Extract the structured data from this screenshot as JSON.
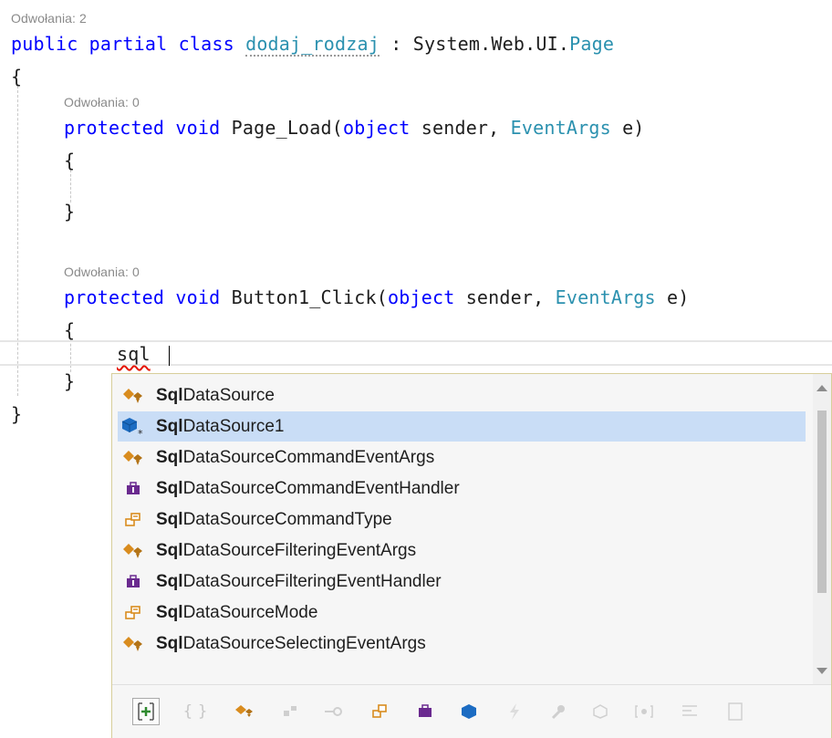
{
  "codelens": {
    "class_refs": "Odwołania: 2",
    "page_load_refs": "Odwołania: 0",
    "button_click_refs": "Odwołania: 0"
  },
  "code": {
    "l1_kw": "public partial class",
    "l1_name": "dodaj_rodzaj",
    "l1_colon": " : ",
    "l1_ns": "System.Web.UI.",
    "l1_type": "Page",
    "open_brace": "{",
    "close_brace": "}",
    "pl_kw": "protected void",
    "pl_name": " Page_Load(",
    "pl_obj": "object",
    "pl_sender": " sender, ",
    "pl_evt": "EventArgs",
    "pl_end": " e)",
    "bc_kw": "protected void",
    "bc_name": " Button1_Click(",
    "bc_obj": "object",
    "bc_sender": " sender, ",
    "bc_evt": "EventArgs",
    "bc_end": " e)",
    "typed": "sql"
  },
  "completion": {
    "items": [
      {
        "bold": "Sql",
        "rest": "DataSource",
        "icon": "class-icon"
      },
      {
        "bold": "Sql",
        "rest": "DataSource1",
        "icon": "field-icon"
      },
      {
        "bold": "Sql",
        "rest": "DataSourceCommandEventArgs",
        "icon": "class-icon"
      },
      {
        "bold": "Sql",
        "rest": "DataSourceCommandEventHandler",
        "icon": "delegate-icon"
      },
      {
        "bold": "Sql",
        "rest": "DataSourceCommandType",
        "icon": "enum-icon"
      },
      {
        "bold": "Sql",
        "rest": "DataSourceFilteringEventArgs",
        "icon": "class-icon"
      },
      {
        "bold": "Sql",
        "rest": "DataSourceFilteringEventHandler",
        "icon": "delegate-icon"
      },
      {
        "bold": "Sql",
        "rest": "DataSourceMode",
        "icon": "enum-icon"
      },
      {
        "bold": "Sql",
        "rest": "DataSourceSelectingEventArgs",
        "icon": "class-icon"
      }
    ],
    "selected_index": 1
  },
  "filters": {
    "expand_glyph": "[+]",
    "braces_glyph": "{ }"
  },
  "colors": {
    "keyword": "#0000ff",
    "type": "#2b91af",
    "selection": "#c9ddf6",
    "class_icon": "#d98c1e",
    "delegate_icon": "#6a2a8f",
    "field_icon": "#1c6cc2"
  }
}
